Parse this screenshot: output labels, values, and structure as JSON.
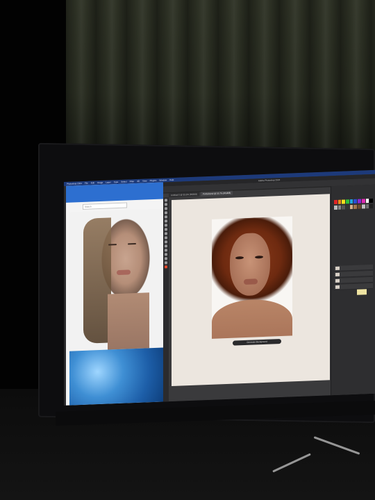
{
  "scene": {
    "description_colors": {
      "curtain": "#2f3326",
      "background": "#050505",
      "menubar": "#1d3a7a",
      "accent_blue": "#2d6fd0",
      "photoshop_ui": "#3a3a3c",
      "canvas": "#ece6df"
    }
  },
  "menubar": {
    "items": [
      "Photoshop 2024",
      "File",
      "Edit",
      "Image",
      "Layer",
      "Type",
      "Select",
      "Filter",
      "3D",
      "View",
      "Plugins",
      "Window",
      "Help"
    ]
  },
  "photoshop": {
    "window_title": "Adobe Photoshop 2024",
    "tabs": [
      "Untitled-5 @ 33.3% (RGB/8)",
      "Portrait.psd @ 16.7% (RGB/8)"
    ],
    "canvas_pill_label": "Generate Background"
  },
  "left_window": {
    "search_placeholder": "Search"
  },
  "icons": {
    "tools": [
      "move-tool-icon",
      "marquee-tool-icon",
      "lasso-tool-icon",
      "crop-tool-icon",
      "eyedropper-icon",
      "brush-icon",
      "stamp-icon",
      "eraser-icon",
      "gradient-icon",
      "dodge-icon",
      "pen-icon",
      "type-icon",
      "path-select-icon",
      "shape-icon",
      "hand-icon",
      "zoom-icon"
    ]
  }
}
